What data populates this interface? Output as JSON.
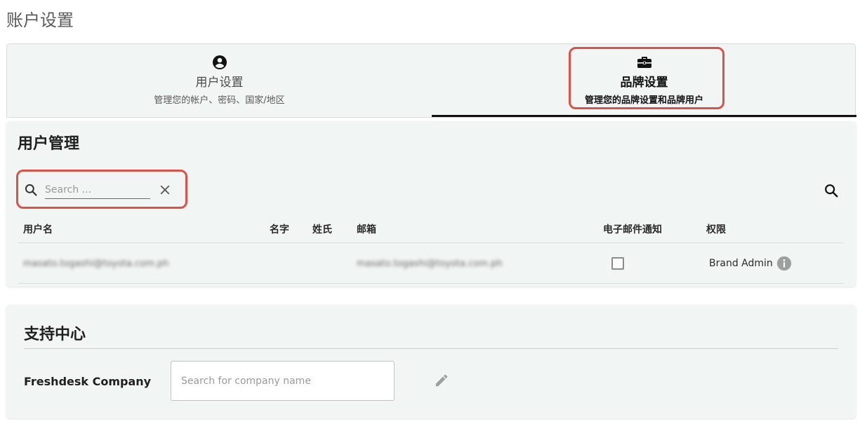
{
  "page": {
    "title": "账户设置"
  },
  "tabs": [
    {
      "title": "用户设置",
      "subtitle": "管理您的帐户、密码、国家/地区",
      "icon": "account-circle-icon",
      "active": false
    },
    {
      "title": "品牌设置",
      "subtitle": "管理您的品牌设置和品牌用户",
      "icon": "briefcase-icon",
      "active": true
    }
  ],
  "user_management": {
    "title": "用户管理",
    "search": {
      "placeholder": "Search ...",
      "value": ""
    },
    "columns": [
      "用户名",
      "名字",
      "姓氏",
      "邮箱",
      "电子邮件通知",
      "权限"
    ],
    "rows": [
      {
        "username": "masato.togashi@toyota.com.ph",
        "first_name": "",
        "last_name": "",
        "email": "masato.togashi@toyota.com.ph",
        "email_notify": false,
        "role": "Brand Admin"
      }
    ]
  },
  "support_center": {
    "title": "支持中心",
    "company_label": "Freshdesk Company",
    "company_placeholder": "Search for company name"
  },
  "colors": {
    "highlight": "#d9534a",
    "card_bg": "#f1f5f3",
    "active_tab_underline": "#111111"
  }
}
